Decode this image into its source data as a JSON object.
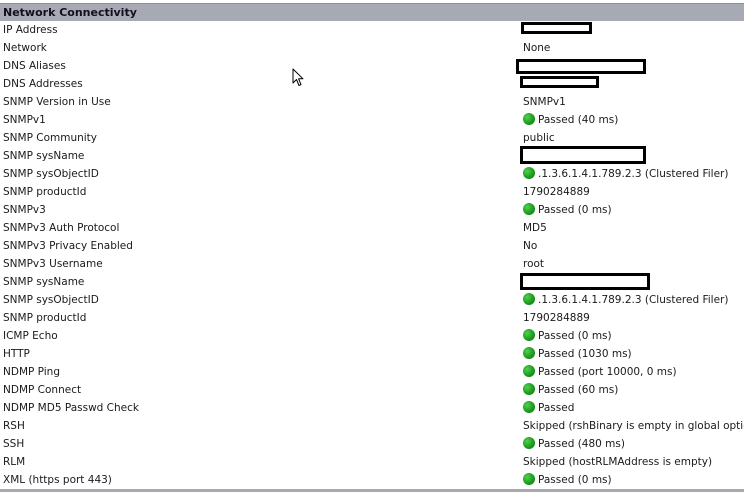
{
  "section": {
    "title": "Network Connectivity"
  },
  "rows": [
    {
      "label": "IP Address",
      "value": "",
      "status": "",
      "redacted": true
    },
    {
      "label": "Network",
      "value": "None",
      "status": ""
    },
    {
      "label": "DNS Aliases",
      "value": "",
      "status": "",
      "redacted": true
    },
    {
      "label": "DNS Addresses",
      "value": "",
      "status": "",
      "redacted": true
    },
    {
      "label": "SNMP Version in Use",
      "value": "SNMPv1",
      "status": ""
    },
    {
      "label": "SNMPv1",
      "value": "Passed (40 ms)",
      "status": "passed"
    },
    {
      "label": "SNMP Community",
      "value": "public",
      "status": ""
    },
    {
      "label": "SNMP sysName",
      "value": "",
      "status": "",
      "redacted": true
    },
    {
      "label": "SNMP sysObjectID",
      "value": ".1.3.6.1.4.1.789.2.3 (Clustered Filer)",
      "status": "passed"
    },
    {
      "label": "SNMP productId",
      "value": "1790284889",
      "status": ""
    },
    {
      "label": "SNMPv3",
      "value": "Passed (0 ms)",
      "status": "passed"
    },
    {
      "label": "SNMPv3 Auth Protocol",
      "value": "MD5",
      "status": ""
    },
    {
      "label": "SNMPv3 Privacy Enabled",
      "value": "No",
      "status": ""
    },
    {
      "label": "SNMPv3 Username",
      "value": "root",
      "status": ""
    },
    {
      "label": "SNMP sysName",
      "value": "",
      "status": "",
      "redacted": true
    },
    {
      "label": "SNMP sysObjectID",
      "value": ".1.3.6.1.4.1.789.2.3 (Clustered Filer)",
      "status": "passed"
    },
    {
      "label": "SNMP productId",
      "value": "1790284889",
      "status": ""
    },
    {
      "label": "ICMP Echo",
      "value": "Passed (0 ms)",
      "status": "passed"
    },
    {
      "label": "HTTP",
      "value": "Passed (1030 ms)",
      "status": "passed"
    },
    {
      "label": "NDMP Ping",
      "value": "Passed (port 10000, 0 ms)",
      "status": "passed"
    },
    {
      "label": "NDMP Connect",
      "value": "Passed (60 ms)",
      "status": "passed"
    },
    {
      "label": "NDMP MD5 Passwd Check",
      "value": "Passed",
      "status": "passed"
    },
    {
      "label": "RSH",
      "value": "Skipped (rshBinary is empty in global option)",
      "status": ""
    },
    {
      "label": "SSH",
      "value": "Passed (480 ms)",
      "status": "passed"
    },
    {
      "label": "RLM",
      "value": "Skipped (hostRLMAddress is empty)",
      "status": ""
    },
    {
      "label": "XML (https port 443)",
      "value": "Passed (0 ms)",
      "status": "passed"
    }
  ],
  "colors": {
    "header_bg": "#a7a9b3",
    "status_passed": "#1f9a1f",
    "redaction": "#000000"
  },
  "icons": {
    "status": "green-status-dot-icon",
    "cursor": "mouse-pointer-icon",
    "redaction": "redaction-box"
  }
}
